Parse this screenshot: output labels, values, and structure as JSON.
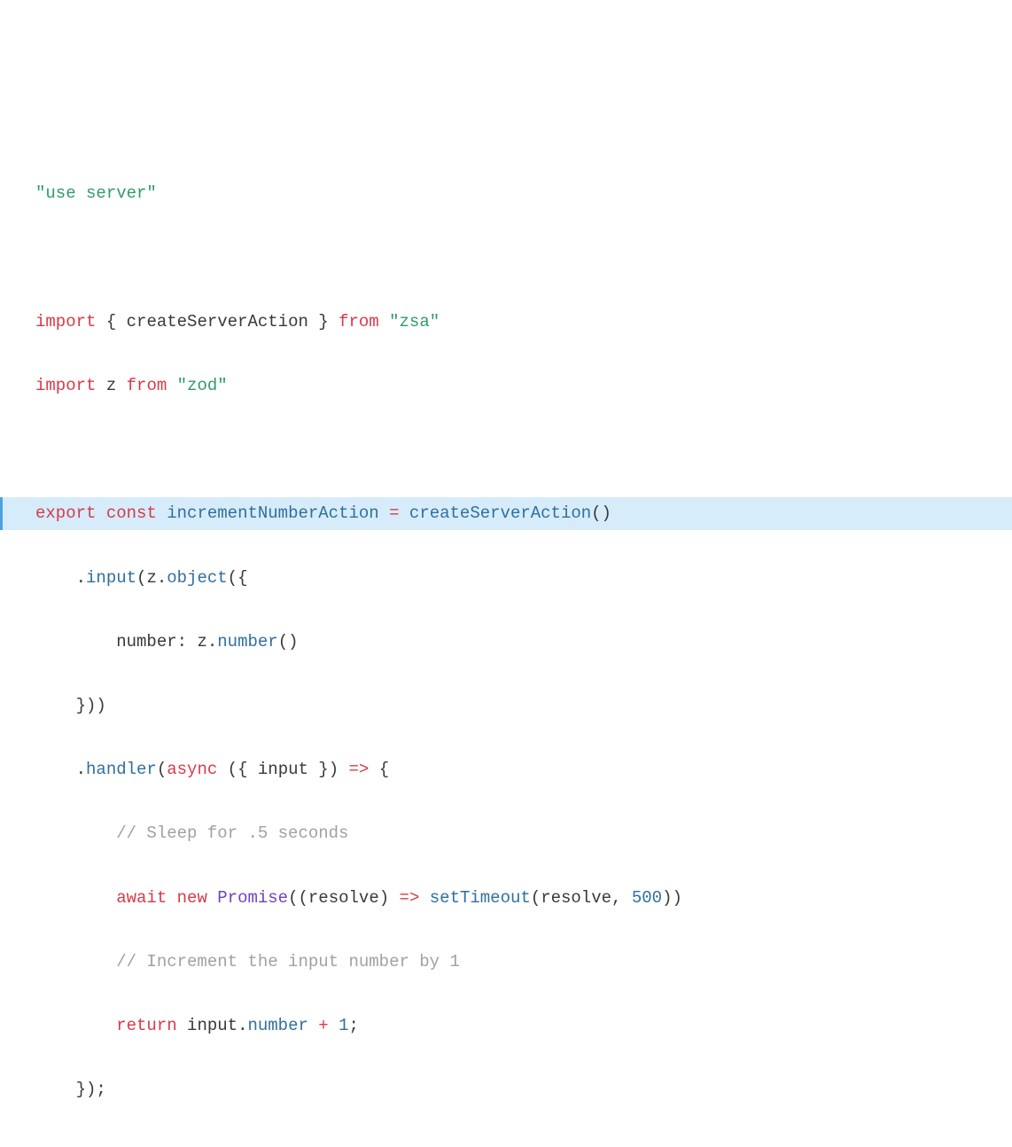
{
  "code": {
    "line1": {
      "str1": "\"use server\""
    },
    "line2": {},
    "line3": {
      "kw1": "import",
      "punct1": " { ",
      "ident1": "createServerAction",
      "punct2": " } ",
      "kw2": "from",
      "sp1": " ",
      "str1": "\"zsa\""
    },
    "line4": {
      "kw1": "import",
      "sp1": " ",
      "ident1": "z",
      "sp2": " ",
      "kw2": "from",
      "sp3": " ",
      "str1": "\"zod\""
    },
    "line5": {},
    "line6": {
      "kw1": "export",
      "sp1": " ",
      "kw2": "const",
      "sp2": " ",
      "def1": "incrementNumberAction",
      "sp3": " ",
      "op1": "=",
      "sp4": " ",
      "fn1": "createServerAction",
      "punct1": "()"
    },
    "line7": {
      "indent": "    ",
      "punct1": ".",
      "fn1": "input",
      "punct2": "(",
      "ident1": "z",
      "punct3": ".",
      "fn2": "object",
      "punct4": "({"
    },
    "line8": {
      "indent": "        ",
      "prop1": "number",
      "punct1": ": ",
      "ident1": "z",
      "punct2": ".",
      "fn1": "number",
      "punct3": "()"
    },
    "line9": {
      "indent": "    ",
      "punct1": "}))"
    },
    "line10": {
      "indent": "    ",
      "punct1": ".",
      "fn1": "handler",
      "punct2": "(",
      "kw1": "async",
      "sp1": " ",
      "punct3": "({ ",
      "ident1": "input",
      "punct4": " }) ",
      "op1": "=>",
      "punct5": " {"
    },
    "line11": {
      "indent": "        ",
      "cmt1": "// Sleep for .5 seconds"
    },
    "line12": {
      "indent": "        ",
      "kw1": "await",
      "sp1": " ",
      "kw2": "new",
      "sp2": " ",
      "cls1": "Promise",
      "punct1": "((",
      "ident1": "resolve",
      "punct2": ") ",
      "op1": "=>",
      "sp3": " ",
      "fn1": "setTimeout",
      "punct3": "(",
      "ident2": "resolve",
      "punct4": ", ",
      "num1": "500",
      "punct5": "))"
    },
    "line13": {
      "indent": "        ",
      "cmt1": "// Increment the input number by 1"
    },
    "line14": {
      "indent": "        ",
      "kw1": "return",
      "sp1": " ",
      "ident1": "input",
      "punct1": ".",
      "prop1": "number",
      "sp2": " ",
      "op1": "+",
      "sp3": " ",
      "num1": "1",
      "punct2": ";"
    },
    "line15": {
      "indent": "    ",
      "punct1": "});"
    }
  }
}
